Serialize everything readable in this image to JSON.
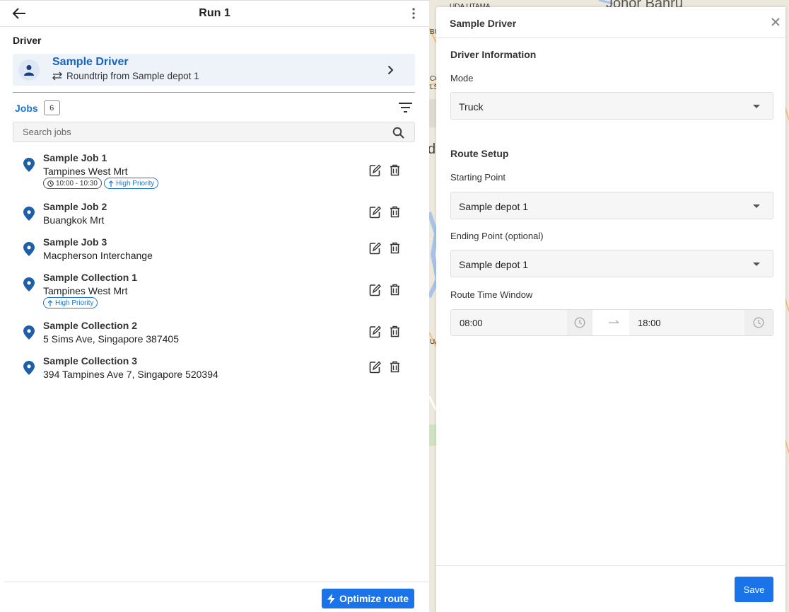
{
  "header": {
    "title": "Run 1"
  },
  "driver_section": {
    "label": "Driver",
    "driver_name": "Sample Driver",
    "route_desc": "Roundtrip from Sample depot 1"
  },
  "jobs": {
    "tab_label": "Jobs",
    "count": "6",
    "search_placeholder": "Search jobs",
    "items": [
      {
        "title": "Sample Job 1",
        "address": "Tampines West Mrt",
        "time_window": "10:00 - 10:30",
        "priority": "High Priority"
      },
      {
        "title": "Sample Job 2",
        "address": "Buangkok Mrt"
      },
      {
        "title": "Sample Job 3",
        "address": "Macpherson Interchange"
      },
      {
        "title": "Sample Collection 1",
        "address": "Tampines West Mrt",
        "priority": "High Priority"
      },
      {
        "title": "Sample Collection 2",
        "address": "5 Sims Ave, Singapore 387405"
      },
      {
        "title": "Sample Collection 3",
        "address": "394 Tampines Ave 7, Singapore 520394"
      }
    ]
  },
  "footer": {
    "optimize_label": "Optimize route"
  },
  "map": {
    "labels": [
      "UDA UTAMA",
      "Johor Bahru",
      "BU",
      "CO",
      "LS",
      "da",
      "UA"
    ]
  },
  "drawer": {
    "title": "Sample Driver",
    "driver_info_heading": "Driver Information",
    "mode_label": "Mode",
    "mode_value": "Truck",
    "route_setup_heading": "Route Setup",
    "start_label": "Starting Point",
    "start_value": "Sample depot 1",
    "end_label": "Ending Point (optional)",
    "end_value": "Sample depot 1",
    "time_window_label": "Route Time Window",
    "time_start": "08:00",
    "time_end": "18:00",
    "save_label": "Save"
  },
  "colors": {
    "accent": "#1a73e8",
    "link": "#1565c0",
    "pin": "#1e5fa8"
  }
}
